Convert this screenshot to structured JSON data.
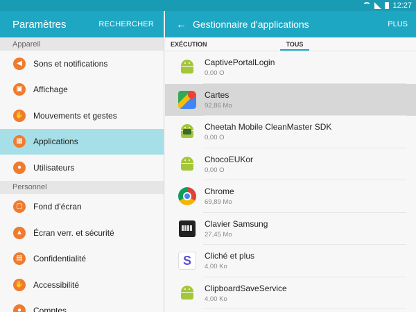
{
  "status_bar": {
    "time": "12:27"
  },
  "left_panel": {
    "title": "Paramètres",
    "search_label": "RECHERCHER",
    "sections": [
      {
        "label": "Appareil",
        "items": [
          {
            "label": "Sons et notifications",
            "icon": "volume-icon",
            "glyph": "◀",
            "selected": false
          },
          {
            "label": "Affichage",
            "icon": "display-icon",
            "glyph": "▣",
            "selected": false
          },
          {
            "label": "Mouvements et gestes",
            "icon": "gesture-icon",
            "glyph": "✋",
            "selected": false
          },
          {
            "label": "Applications",
            "icon": "apps-grid-icon",
            "glyph": "▦",
            "selected": true
          },
          {
            "label": "Utilisateurs",
            "icon": "users-icon",
            "glyph": "●",
            "selected": false
          }
        ]
      },
      {
        "label": "Personnel",
        "items": [
          {
            "label": "Fond d'écran",
            "icon": "wallpaper-icon",
            "glyph": "▢",
            "selected": false
          },
          {
            "label": "Écran verr. et sécurité",
            "icon": "lock-icon",
            "glyph": "▲",
            "selected": false
          },
          {
            "label": "Confidentialité",
            "icon": "privacy-icon",
            "glyph": "▤",
            "selected": false
          },
          {
            "label": "Accessibilité",
            "icon": "accessibility-icon",
            "glyph": "✋",
            "selected": false
          },
          {
            "label": "Comptes",
            "icon": "key-icon",
            "glyph": "●",
            "selected": false
          }
        ]
      }
    ]
  },
  "right_panel": {
    "title": "Gestionnaire d'applications",
    "more_label": "PLUS",
    "tabs": [
      {
        "label": "EXÉCUTION",
        "active": false
      },
      {
        "label": "TOUS",
        "active": true
      }
    ],
    "apps": [
      {
        "name": "CaptivePortalLogin",
        "size": "0,00 O",
        "icon": "android-icon"
      },
      {
        "name": "Cartes",
        "size": "92,86 Mo",
        "icon": "maps-icon",
        "highlight": true
      },
      {
        "name": "Cheetah Mobile CleanMaster SDK",
        "size": "0,00 O",
        "icon": "cheetah-icon"
      },
      {
        "name": "ChocoEUKor",
        "size": "0,00 O",
        "icon": "android-icon"
      },
      {
        "name": "Chrome",
        "size": "69,89 Mo",
        "icon": "chrome-icon"
      },
      {
        "name": "Clavier Samsung",
        "size": "27,45 Mo",
        "icon": "keyboard-icon"
      },
      {
        "name": "Cliché et plus",
        "size": "4,00 Ko",
        "icon": "cliche-icon"
      },
      {
        "name": "ClipboardSaveService",
        "size": "4,00 Ko",
        "icon": "android-icon"
      }
    ]
  },
  "colors": {
    "header": "#1ea7c3",
    "selected_item": "#a7dfe9",
    "menu_icon": "#f07b2e",
    "highlight_row": "#d7d7d7"
  }
}
